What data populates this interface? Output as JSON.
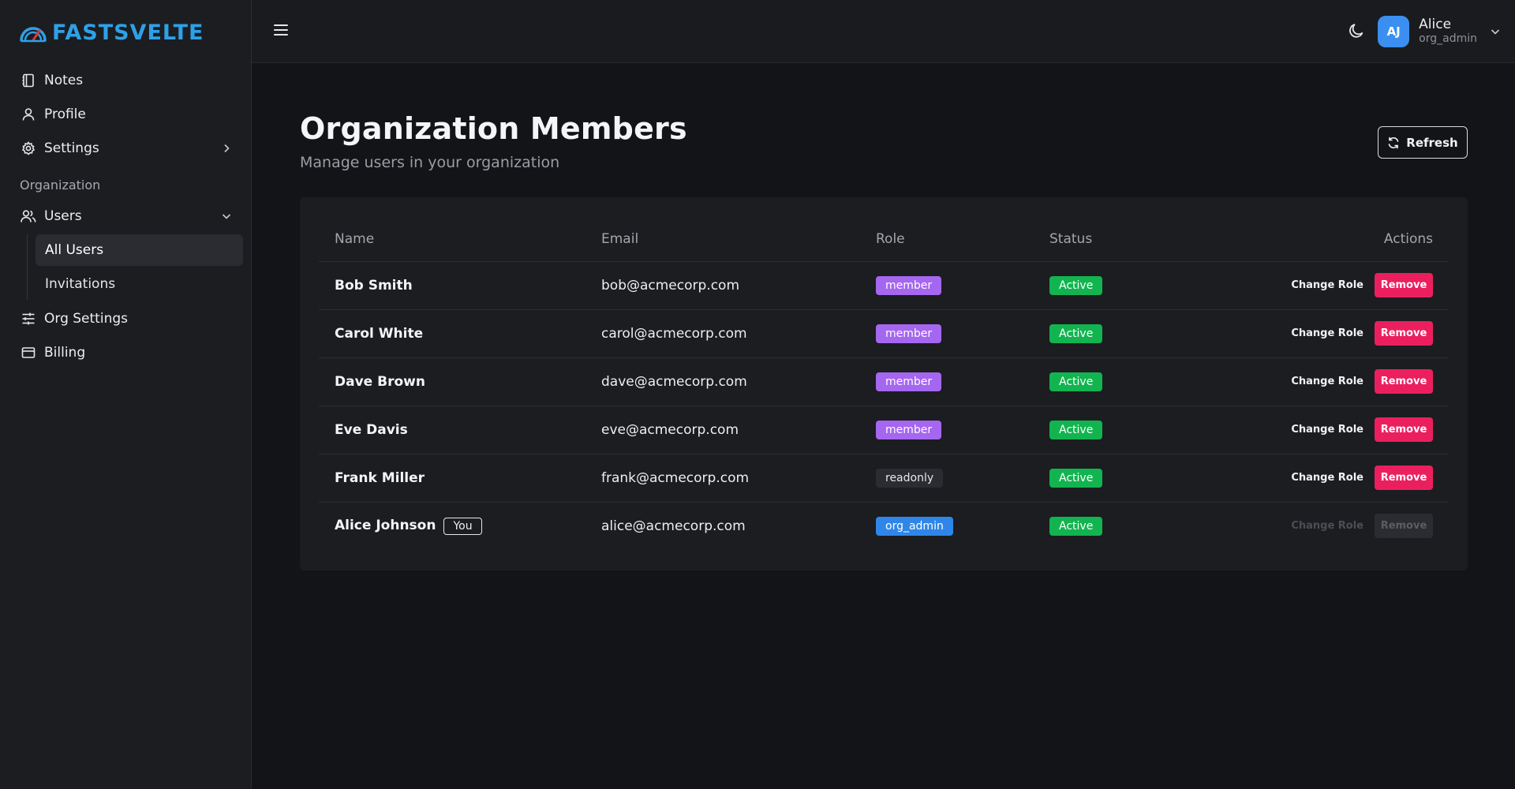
{
  "brand": {
    "name": "FASTSVELTE",
    "color": "#2da1e8"
  },
  "sidebar": {
    "items": [
      {
        "label": "Notes",
        "icon": "notebook-icon"
      },
      {
        "label": "Profile",
        "icon": "user-icon"
      },
      {
        "label": "Settings",
        "icon": "gear-icon"
      }
    ],
    "section_label": "Organization",
    "users_label": "Users",
    "users_sub": [
      {
        "label": "All Users",
        "active": true
      },
      {
        "label": "Invitations",
        "active": false
      }
    ],
    "org_items": [
      {
        "label": "Org Settings",
        "icon": "sliders-icon"
      },
      {
        "label": "Billing",
        "icon": "credit-card-icon"
      }
    ]
  },
  "header": {
    "user": {
      "initials": "AJ",
      "name": "Alice",
      "role": "org_admin"
    }
  },
  "page": {
    "title": "Organization Members",
    "subtitle": "Manage users in your organization",
    "refresh_label": "Refresh"
  },
  "table": {
    "columns": [
      "Name",
      "Email",
      "Role",
      "Status",
      "Actions"
    ],
    "change_role_label": "Change Role",
    "remove_label": "Remove",
    "you_label": "You",
    "rows": [
      {
        "name": "Bob Smith",
        "email": "bob@acmecorp.com",
        "role": "member",
        "status": "Active"
      },
      {
        "name": "Carol White",
        "email": "carol@acmecorp.com",
        "role": "member",
        "status": "Active"
      },
      {
        "name": "Dave Brown",
        "email": "dave@acmecorp.com",
        "role": "member",
        "status": "Active"
      },
      {
        "name": "Eve Davis",
        "email": "eve@acmecorp.com",
        "role": "member",
        "status": "Active"
      },
      {
        "name": "Frank Miller",
        "email": "frank@acmecorp.com",
        "role": "readonly",
        "status": "Active"
      },
      {
        "name": "Alice Johnson",
        "email": "alice@acmecorp.com",
        "role": "org_admin",
        "status": "Active"
      }
    ]
  },
  "colors": {
    "member_badge": "#a566f0",
    "admin_badge": "#2f86e8",
    "active_badge": "#12b44f",
    "remove_button": "#ec1f5e"
  }
}
